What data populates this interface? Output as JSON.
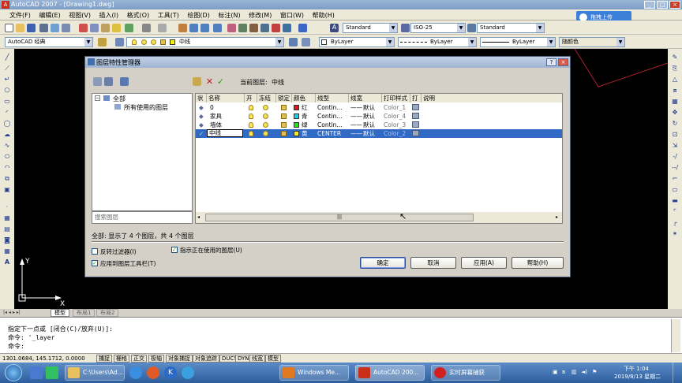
{
  "app": {
    "title": "AutoCAD 2007 - [Drawing1.dwg]",
    "menu": [
      "文件(F)",
      "编辑(E)",
      "视图(V)",
      "插入(I)",
      "格式(O)",
      "工具(T)",
      "绘图(D)",
      "标注(N)",
      "修改(M)",
      "窗口(W)",
      "帮助(H)"
    ],
    "cloud_button": "拖拽上传",
    "workspace": "AutoCAD 经典",
    "layer_combo": "中线",
    "style_text": "Standard",
    "style_dim": "ISO-25",
    "style_table": "Standard",
    "color_combo": "ByLayer",
    "linetype_combo": "ByLayer",
    "lineweight_combo": "ByLayer",
    "plotstyle_combo": "随颜色"
  },
  "dialog": {
    "title": "图层特性管理器",
    "current_layer_label": "当前图层:",
    "current_layer": "中线",
    "tree": {
      "root": "全部",
      "child": "所有使用的图层"
    },
    "search_placeholder": "搜索图层",
    "columns": [
      "状",
      "名称",
      "开",
      "冻结",
      "锁定",
      "颜色",
      "线型",
      "线宽",
      "打印样式",
      "打",
      "说明"
    ],
    "layers": [
      {
        "name": "0",
        "color_name": "红",
        "color": "#e0141e",
        "linetype": "Contin...",
        "lineweight": "默认",
        "plotstyle": "Color_1"
      },
      {
        "name": "家具",
        "color_name": "青",
        "color": "#14d2e6",
        "linetype": "Contin...",
        "lineweight": "默认",
        "plotstyle": "Color_4"
      },
      {
        "name": "墙体",
        "color_name": "绿",
        "color": "#1ee61e",
        "linetype": "Contin...",
        "lineweight": "默认",
        "plotstyle": "Color_3"
      },
      {
        "name": "中线",
        "color_name": "黄",
        "color": "#f0f01e",
        "linetype": "CENTER",
        "lineweight": "默认",
        "plotstyle": "Color_2"
      }
    ],
    "status_text": "全部: 显示了 4 个图层，共 4 个图层",
    "invert_filter": "反转过滤器(I)",
    "apply_toolbar": "应用到图层工具栏(T)",
    "indicate_used": "指示正在使用的图层(U)",
    "ok": "确定",
    "cancel": "取消",
    "apply": "应用(A)",
    "help": "帮助(H)"
  },
  "tabs": [
    "模型",
    "布局1",
    "布局2"
  ],
  "command": {
    "line1": "指定下一点或 [闭合(C)/放弃(U)]:",
    "line2": "命令: '_layer",
    "line3": "命令:"
  },
  "status": {
    "coords": "1301.0684, 145.1712, 0.0000",
    "toggles": [
      "捕捉",
      "栅格",
      "正交",
      "极轴",
      "对象捕捉",
      "对象追踪",
      "DUCS",
      "DYN",
      "线宽",
      "模型"
    ]
  },
  "taskbar": {
    "tasks": [
      "C:\\Users\\Ad...",
      "Windows Me...",
      "AutoCAD 200...",
      "实时屏幕捕获"
    ],
    "time": "下午 1:04",
    "date": "2019/8/13 星期二"
  }
}
